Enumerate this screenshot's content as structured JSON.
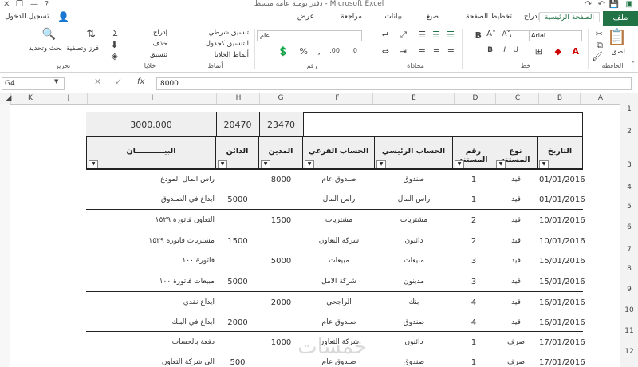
{
  "window": {
    "title": "دفتر يومية عامة مبسط - Microsoft Excel",
    "help": "?",
    "signin": "تسجيل الدخول"
  },
  "tabs": [
    "ملف",
    "الصفحة الرئيسية",
    "إدراج",
    "تخطيط الصفحة",
    "صيغ",
    "بيانات",
    "مراجعة",
    "عرض"
  ],
  "ribbon": {
    "clipboard": {
      "label": "الحافظة",
      "paste": "لصق"
    },
    "font": {
      "label": "خط",
      "name": "Arial",
      "size": "١٠"
    },
    "alignment": {
      "label": "محاذاة"
    },
    "number": {
      "label": "رقم",
      "format": "عام"
    },
    "styles": {
      "label": "أنماط",
      "cond": "تنسيق شرطي",
      "table": "التنسيق كجدول",
      "cell": "أنماط الخلايا"
    },
    "cells": {
      "label": "خلايا",
      "insert": "إدراج",
      "delete": "حذف",
      "format": "تنسيق"
    },
    "editing": {
      "label": "تحرير",
      "sort": "فرز وتصفية",
      "find": "بحث وتحديد"
    }
  },
  "formula_bar": {
    "name_box": "G4",
    "value": "8000",
    "fx": "fx"
  },
  "columns": [
    "A",
    "B",
    "C",
    "D",
    "E",
    "F",
    "G",
    "H",
    "I",
    "J",
    "K"
  ],
  "rows": [
    "1",
    "2",
    "3",
    "4",
    "5",
    "6",
    "7",
    "8",
    "9",
    "10",
    "11",
    "12"
  ],
  "totals": {
    "balance": "3000.000",
    "credit": "20470",
    "debit": "23470"
  },
  "headers": {
    "date": "التاريخ",
    "doc_type": "نوع المستند",
    "doc_no": "رقم المستند",
    "main": "الحساب الرئيسي",
    "sub": "الحساب الفرعي",
    "debit": "المدين",
    "credit": "الدائن",
    "desc": "البيـــــــــــان"
  },
  "entries": [
    {
      "date": "01/01/2016",
      "type": "قيد",
      "no": "1",
      "main": "صندوق",
      "sub": "صندوق عام",
      "debit": "8000",
      "credit": "",
      "desc": "راس المال المودع"
    },
    {
      "date": "01/01/2016",
      "type": "قيد",
      "no": "1",
      "main": "راس المال",
      "sub": "راس المال",
      "debit": "",
      "credit": "5000",
      "desc": "ايداع في الصندوق"
    },
    {
      "date": "10/01/2016",
      "type": "قيد",
      "no": "2",
      "main": "مشتريات",
      "sub": "مشتريات",
      "debit": "1500",
      "credit": "",
      "desc": "التعاون فاتورة ١٥٢٩"
    },
    {
      "date": "10/01/2016",
      "type": "قيد",
      "no": "2",
      "main": "دائنون",
      "sub": "شركة التعاون",
      "debit": "",
      "credit": "1500",
      "desc": "مشتريات فاتورة ١٥٢٩"
    },
    {
      "date": "15/01/2016",
      "type": "قيد",
      "no": "3",
      "main": "مبيعات",
      "sub": "مبيعات",
      "debit": "5000",
      "credit": "",
      "desc": "فاتورة ١٠٠"
    },
    {
      "date": "15/01/2016",
      "type": "قيد",
      "no": "3",
      "main": "مدينون",
      "sub": "شركة الامل",
      "debit": "",
      "credit": "5000",
      "desc": "مبيعات فاتورة ١٠٠"
    },
    {
      "date": "16/01/2016",
      "type": "قيد",
      "no": "4",
      "main": "بنك",
      "sub": "الراجحي",
      "debit": "2000",
      "credit": "",
      "desc": "ايداع نقدي"
    },
    {
      "date": "16/01/2016",
      "type": "قيد",
      "no": "4",
      "main": "صندوق",
      "sub": "صندوق عام",
      "debit": "",
      "credit": "2000",
      "desc": "ايداع في البنك"
    },
    {
      "date": "17/01/2016",
      "type": "صرف",
      "no": "1",
      "main": "دائنون",
      "sub": "شركة التعاون",
      "debit": "1000",
      "credit": "",
      "desc": "دفعة بالحساب"
    },
    {
      "date": "17/01/2016",
      "type": "صرف",
      "no": "1",
      "main": "صندوق",
      "sub": "صندوق عام",
      "debit": "",
      "credit": "500",
      "desc": "الى شركة التعاون"
    }
  ],
  "watermark": "خمسات",
  "colors": {
    "accent": "#217346"
  }
}
